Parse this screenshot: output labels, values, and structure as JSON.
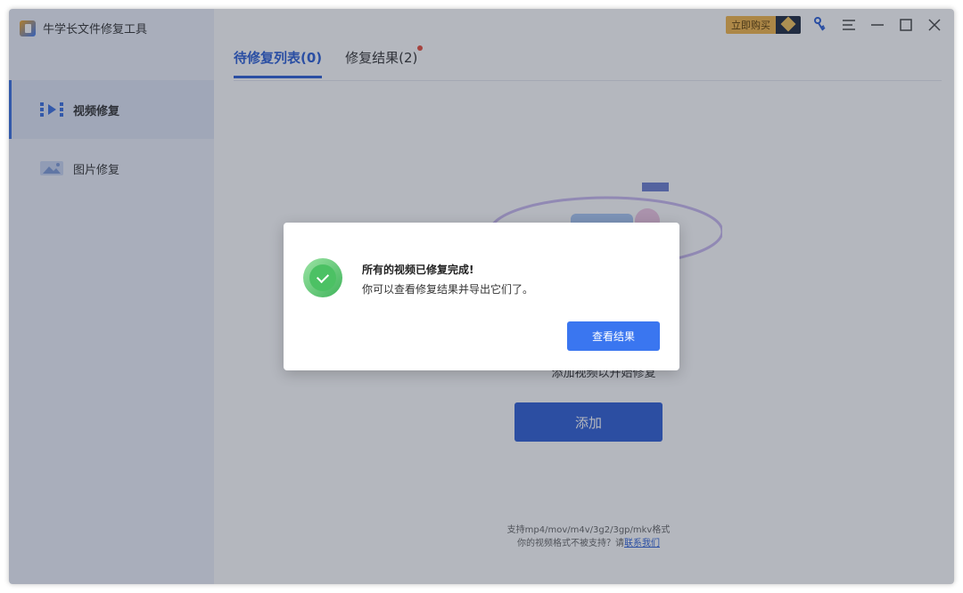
{
  "app": {
    "title": "牛学长文件修复工具"
  },
  "topbar": {
    "buy_label": "立即购买"
  },
  "sidebar": {
    "items": [
      {
        "label": "视频修复",
        "icon": "video-icon",
        "active": true
      },
      {
        "label": "图片修复",
        "icon": "image-icon",
        "active": false
      }
    ]
  },
  "tabs": [
    {
      "label": "待修复列表(0)",
      "active": true
    },
    {
      "label": "修复结果(2)",
      "active": false
    }
  ],
  "main": {
    "hint": "添加视频以开始修复",
    "add_label": "添加",
    "support_formats": "支持mp4/mov/m4v/3g2/3gp/mkv格式",
    "support_question": "你的视频格式不被支持？请",
    "contact_link": "联系我们"
  },
  "dialog": {
    "title": "所有的视频已修复完成!",
    "message": "你可以查看修复结果并导出它们了。",
    "button": "查看结果"
  },
  "colors": {
    "accent": "#2f5ed4",
    "sidebar_bg": "#eef2fa",
    "success": "#4cc164",
    "badge": "#f3b649"
  }
}
